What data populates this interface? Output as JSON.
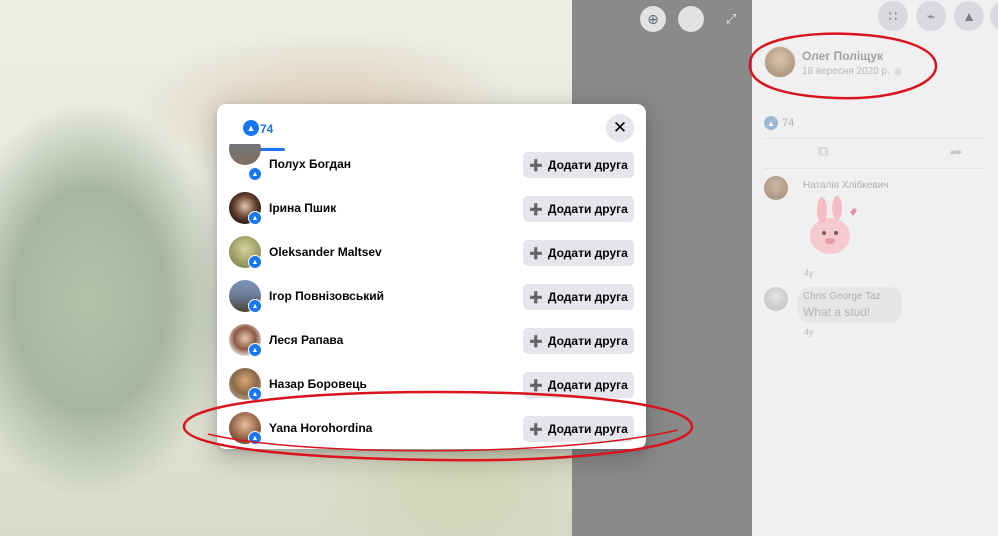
{
  "viewer": {
    "zoom_icon": "zoom-in-icon",
    "tag_icon": "tag-icon",
    "fullscreen_icon": "fullscreen-icon"
  },
  "topbar": {
    "icons": [
      "menu-grid-icon",
      "messenger-icon",
      "bell-icon",
      "account-icon"
    ]
  },
  "post": {
    "author_name": "Олег Поліщук",
    "date": "18 вересня 2020 р.",
    "privacy_icon": "globe-icon",
    "reaction_count": "74"
  },
  "comments": [
    {
      "author": "Наталія Хлібкевич",
      "text": "",
      "time": "4у",
      "sticker": "pink-bunny-sticker"
    },
    {
      "author": "Chris George Taz",
      "text": "What a stud!",
      "time": "4у"
    }
  ],
  "dialog": {
    "tab_count": "74",
    "tab_icon": "like-icon",
    "close_icon": "close-icon",
    "add_friend_label": "Додати друга",
    "people": [
      {
        "name": "Полух Богдан"
      },
      {
        "name": "Ірина Пшик"
      },
      {
        "name": "Oleksander Maltsev"
      },
      {
        "name": "Ігор Повнізовський"
      },
      {
        "name": "Леся Рапава"
      },
      {
        "name": "Назар Боровець"
      },
      {
        "name": "Yana Horohordina"
      }
    ]
  },
  "colors": {
    "accent": "#1877f2",
    "annotation": "#d9141e",
    "button_bg": "#e4e6eb"
  }
}
